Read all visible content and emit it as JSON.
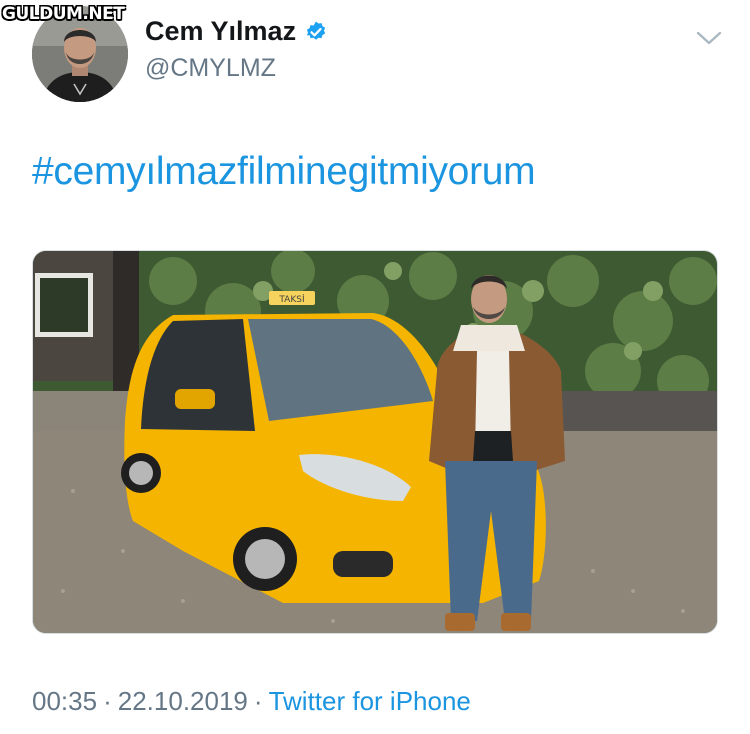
{
  "watermark": {
    "text": "GULDUM.NET"
  },
  "author": {
    "display_name": "Cem Yılmaz",
    "handle": "@CMYLMZ",
    "verified": true,
    "avatar_icon": "profile-avatar"
  },
  "tweet": {
    "text": "#cemyılmazfilminegitmiyorum",
    "media_icon": "photo-man-with-yellow-taxi"
  },
  "meta": {
    "time": "00:35",
    "separator": "·",
    "date": "22.10.2019",
    "source": "Twitter for iPhone"
  },
  "photo_text": {
    "taxi_sign": "TAKSİ"
  },
  "colors": {
    "link": "#1b95e0",
    "verified": "#1da1f2",
    "secondary_text": "#657786",
    "primary_text": "#14171a",
    "taxi_yellow": "#f4b400"
  }
}
